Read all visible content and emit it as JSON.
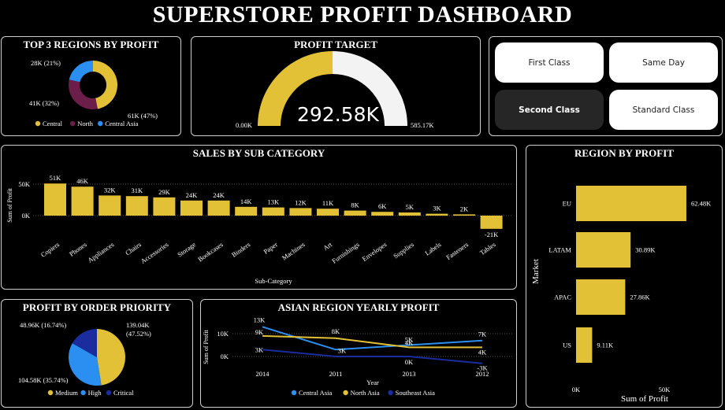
{
  "title": "SUPERSTORE PROFIT DASHBOARD",
  "colors": {
    "gold": "#E2C136",
    "maroon": "#6B1E4A",
    "blue": "#2B8FF2",
    "navy": "#1A2C9E",
    "white": "#F3F3F3",
    "selected": "#262626"
  },
  "slicer": {
    "first": "First Class",
    "same_day": "Same Day",
    "second": "Second Class",
    "standard": "Standard Class",
    "selected": "Second Class"
  },
  "chart_data": [
    {
      "id": "regions",
      "type": "pie",
      "title": "TOP 3 REGIONS BY PROFIT",
      "donut": true,
      "slices": [
        {
          "name": "Central",
          "label": "61K (47%)",
          "value": 61,
          "color": "#E2C136"
        },
        {
          "name": "North",
          "label": "41K (32%)",
          "value": 41,
          "color": "#6B1E4A"
        },
        {
          "name": "Central Asia",
          "label": "28K (21%)",
          "value": 28,
          "color": "#2B8FF2"
        }
      ],
      "legend": [
        "Central",
        "North",
        "Central Asia"
      ]
    },
    {
      "id": "target",
      "type": "gauge",
      "title": "PROFIT TARGET",
      "value": 292.58,
      "max": 585.17,
      "value_label": "292.58K",
      "min_label": "0.00K",
      "max_label": "585.17K"
    },
    {
      "id": "subcat",
      "type": "bar",
      "title": "SALES BY SUB CATEGORY",
      "xlabel": "Sub-Category",
      "ylabel": "Sum of Profit",
      "yticks": [
        "0K",
        "50K"
      ],
      "ylim": [
        -21,
        60
      ],
      "categories": [
        "Copiers",
        "Phones",
        "Appliances",
        "Chairs",
        "Accessories",
        "Storage",
        "Bookcases",
        "Binders",
        "Paper",
        "Machines",
        "Art",
        "Furnishings",
        "Envelopes",
        "Supplies",
        "Labels",
        "Fasteners",
        "Tables"
      ],
      "values": [
        51,
        46,
        32,
        31,
        29,
        24,
        24,
        14,
        13,
        12,
        11,
        8,
        6,
        5,
        3,
        2,
        -21
      ],
      "labels": [
        "51K",
        "46K",
        "32K",
        "31K",
        "29K",
        "24K",
        "24K",
        "14K",
        "13K",
        "12K",
        "11K",
        "8K",
        "6K",
        "5K",
        "3K",
        "2K",
        "-21K"
      ]
    },
    {
      "id": "regionbar",
      "type": "bar",
      "orientation": "horizontal",
      "title": "REGION BY PROFIT",
      "xlabel": "Sum of Profit",
      "ylabel": "Market",
      "xticks": [
        "0K",
        "50K"
      ],
      "xlim": [
        0,
        70
      ],
      "categories": [
        "EU",
        "LATAM",
        "APAC",
        "US"
      ],
      "values": [
        62.48,
        30.89,
        27.86,
        9.11
      ],
      "labels": [
        "62.48K",
        "30.89K",
        "27.86K",
        "9.11K"
      ]
    },
    {
      "id": "priority",
      "type": "pie",
      "title": "PROFIT BY ORDER PRIORITY",
      "slices": [
        {
          "name": "Medium",
          "label": "139.04K (47.52%)",
          "value": 139.04,
          "color": "#E2C136"
        },
        {
          "name": "High",
          "label": "104.58K (35.74%)",
          "value": 104.58,
          "color": "#2B8FF2"
        },
        {
          "name": "Critical",
          "label": "48.96K (16.74%)",
          "value": 48.96,
          "color": "#1A2C9E"
        }
      ],
      "label_a": "139.04K",
      "label_b": "(47.52%)",
      "legend": [
        "Medium",
        "High",
        "Critical"
      ]
    },
    {
      "id": "asian",
      "type": "line",
      "title": "ASIAN REGION YEARLY PROFIT",
      "xlabel": "Year",
      "ylabel": "Sum of Profit",
      "yticks": [
        "0K",
        "10K"
      ],
      "categories": [
        "2014",
        "2011",
        "2013",
        "2012"
      ],
      "series": [
        {
          "name": "Central Asia",
          "color": "#2B8FF2",
          "values": [
            13,
            3,
            5,
            7
          ],
          "labels": [
            "13K",
            "3K",
            "5K",
            "7K"
          ]
        },
        {
          "name": "North Asia",
          "color": "#E2C136",
          "values": [
            9,
            8,
            4,
            4
          ],
          "labels": [
            "9K",
            "8K",
            "4K",
            "4K"
          ]
        },
        {
          "name": "Southeast Asia",
          "color": "#1A2C9E",
          "values": [
            3,
            0,
            0,
            -3
          ],
          "labels": [
            "3K",
            "",
            "0K",
            "-3K"
          ]
        }
      ]
    }
  ]
}
